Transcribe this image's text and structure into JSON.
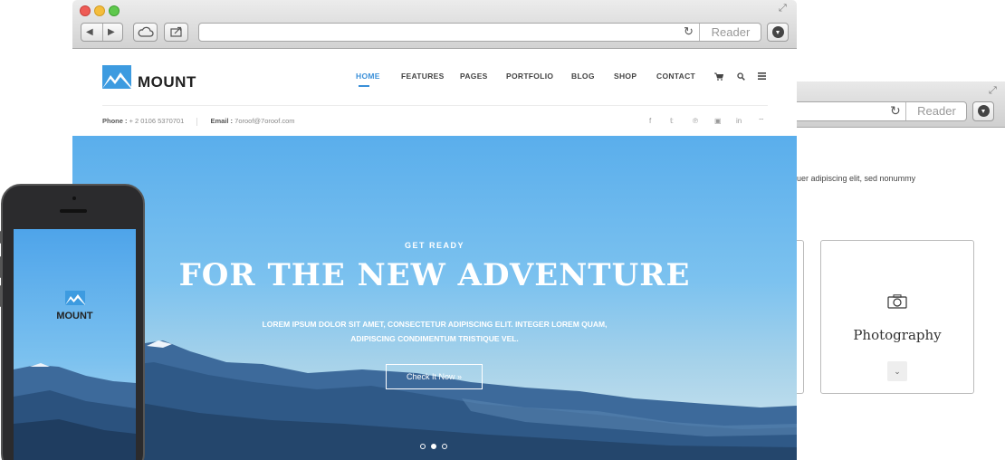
{
  "back_browser": {
    "reader_label": "Reader",
    "body_text": "uer adipiscing elit, sed nonummy",
    "card": {
      "icon": "camera-icon",
      "title": "Photography",
      "toggle_icon": "chevron-down-icon"
    }
  },
  "browser": {
    "reader_label": "Reader",
    "icons": {
      "back": "back-arrow-icon",
      "forward": "forward-arrow-icon",
      "cloud": "cloud-icon",
      "share": "share-icon",
      "reload": "reload-icon",
      "download": "download-icon",
      "expand": "expand-icon"
    }
  },
  "site": {
    "brand": "MOUNT",
    "nav": [
      "HOME",
      "FEATURES",
      "PAGES",
      "PORTFOLIO",
      "BLOG",
      "SHOP",
      "CONTACT"
    ],
    "active_nav": "HOME",
    "nav_icons": [
      "cart-icon",
      "search-icon",
      "menu-icon"
    ],
    "contact": {
      "phone_label": "Phone :",
      "phone_value": "+ 2 0106 5370701",
      "email_label": "Email :",
      "email_value": "7oroof@7oroof.com"
    },
    "social_icons": [
      "facebook-icon",
      "twitter-icon",
      "pinterest-icon",
      "vimeo-icon",
      "linkedin-icon",
      "rss-icon"
    ],
    "hero": {
      "kicker": "GET READY",
      "headline": "FOR THE NEW ADVENTURE",
      "text_line1": "LOREM IPSUM DOLOR SIT AMET, CONSECTETUR ADIPISCING ELIT. INTEGER LOREM QUAM,",
      "text_line2": "ADIPISCING CONDIMENTUM TRISTIQUE VEL.",
      "cta": "Check It Now",
      "slide_count": 3,
      "active_slide": 2
    }
  },
  "phone": {
    "brand": "MOUNT"
  },
  "colors": {
    "accent": "#3a8fd8",
    "logo": "#3d9be0",
    "sky": "#5aaeec"
  }
}
